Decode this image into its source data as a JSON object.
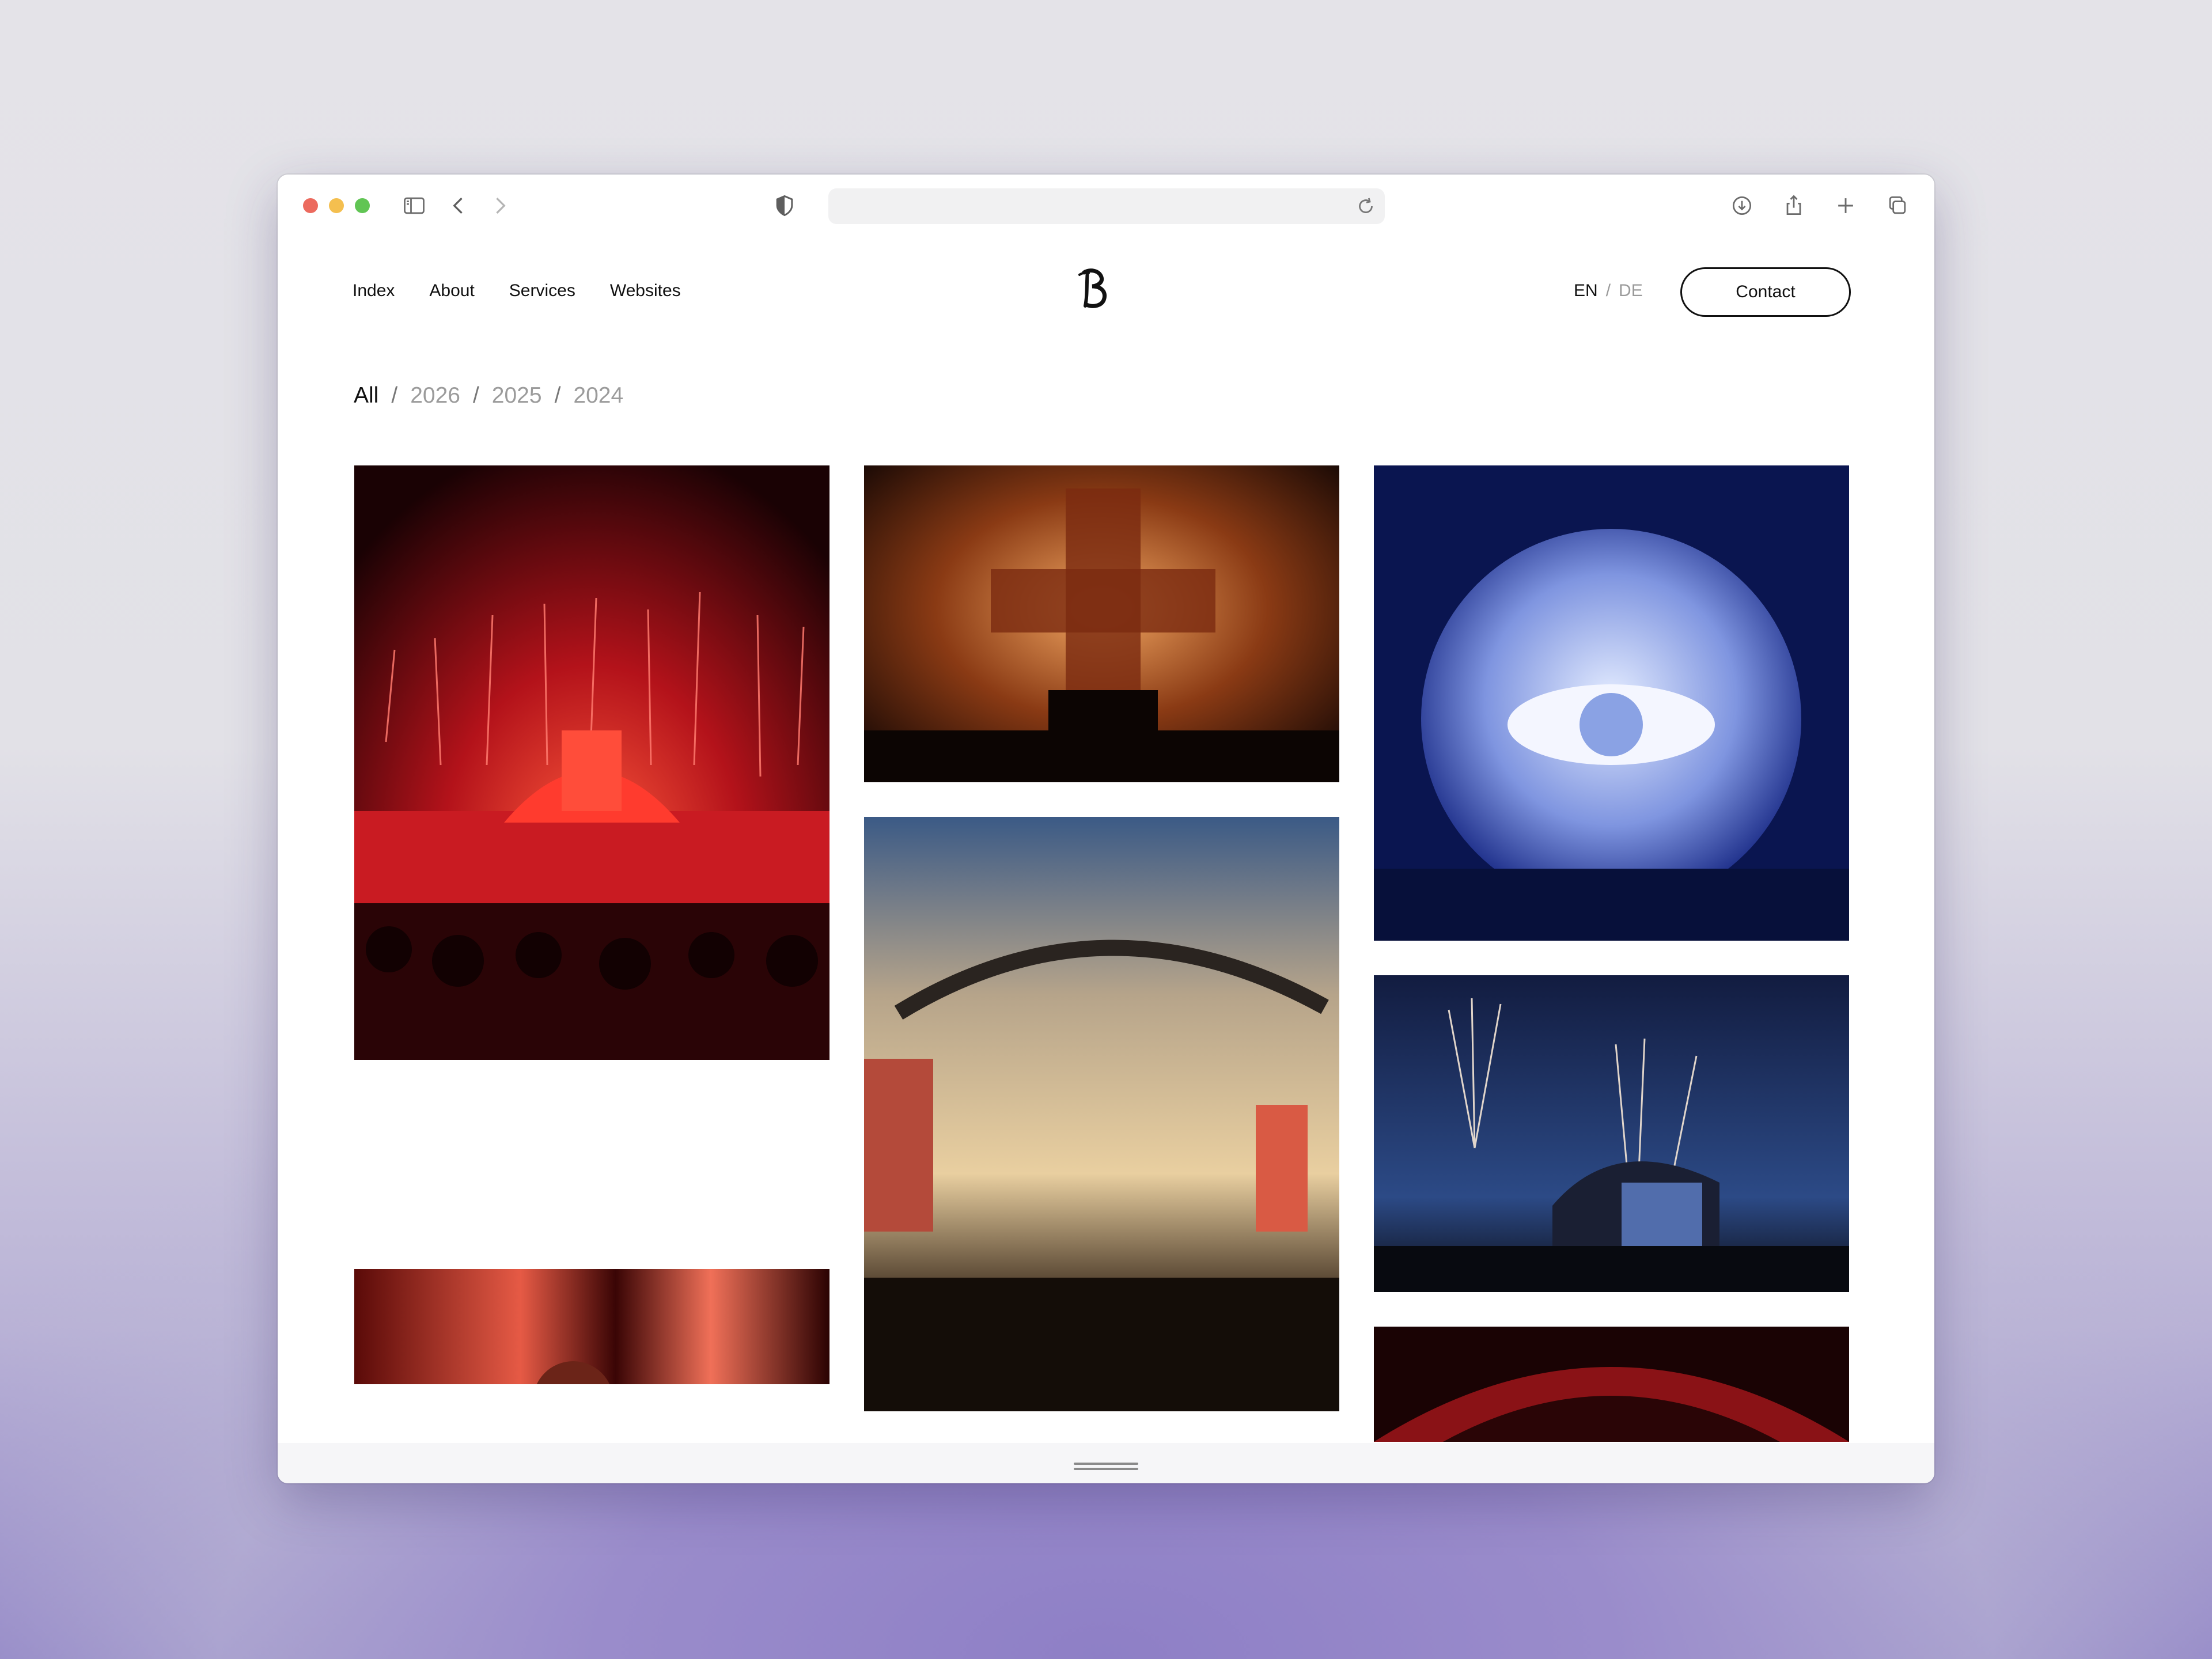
{
  "browser": {
    "icons": [
      "sidebar-icon",
      "back-icon",
      "forward-icon",
      "privacy-shield-icon",
      "reload-icon",
      "download-icon",
      "share-icon",
      "new-tab-icon",
      "tabs-overview-icon"
    ],
    "address": ""
  },
  "site": {
    "nav": [
      "Index",
      "About",
      "Services",
      "Websites"
    ],
    "logo": "BS monogram",
    "lang": {
      "current": "EN",
      "separator": "/",
      "other": "DE"
    },
    "contact_label": "Contact"
  },
  "filters": {
    "items": [
      "All",
      "2026",
      "2025",
      "2024"
    ],
    "separator": "/",
    "active": "All"
  },
  "gallery": {
    "photos": [
      {
        "id": "red-fireworks-stage",
        "description": "festival stage with red fireworks and crowd"
      },
      {
        "id": "confetti-cross-dj",
        "description": "DJ silhouette before glowing cross with confetti"
      },
      {
        "id": "eye-sphere-stage",
        "description": "blue sphere screen showing an eye above DJ booth"
      },
      {
        "id": "dusty-stage-crowd",
        "description": "open air stage with lights and large crowd"
      },
      {
        "id": "dusk-fireworks-stage",
        "description": "stage at dusk with sparkler fireworks"
      },
      {
        "id": "red-dj-portrait",
        "description": "DJ with headphones in red light"
      },
      {
        "id": "red-arch-stage",
        "description": "red lit arch stage, partially visible"
      }
    ]
  },
  "colors": {
    "accent_text": "#111111",
    "muted_text": "#9b9b9b",
    "window_bg": "#ffffff",
    "backdrop_purple": "#8d80c5"
  }
}
